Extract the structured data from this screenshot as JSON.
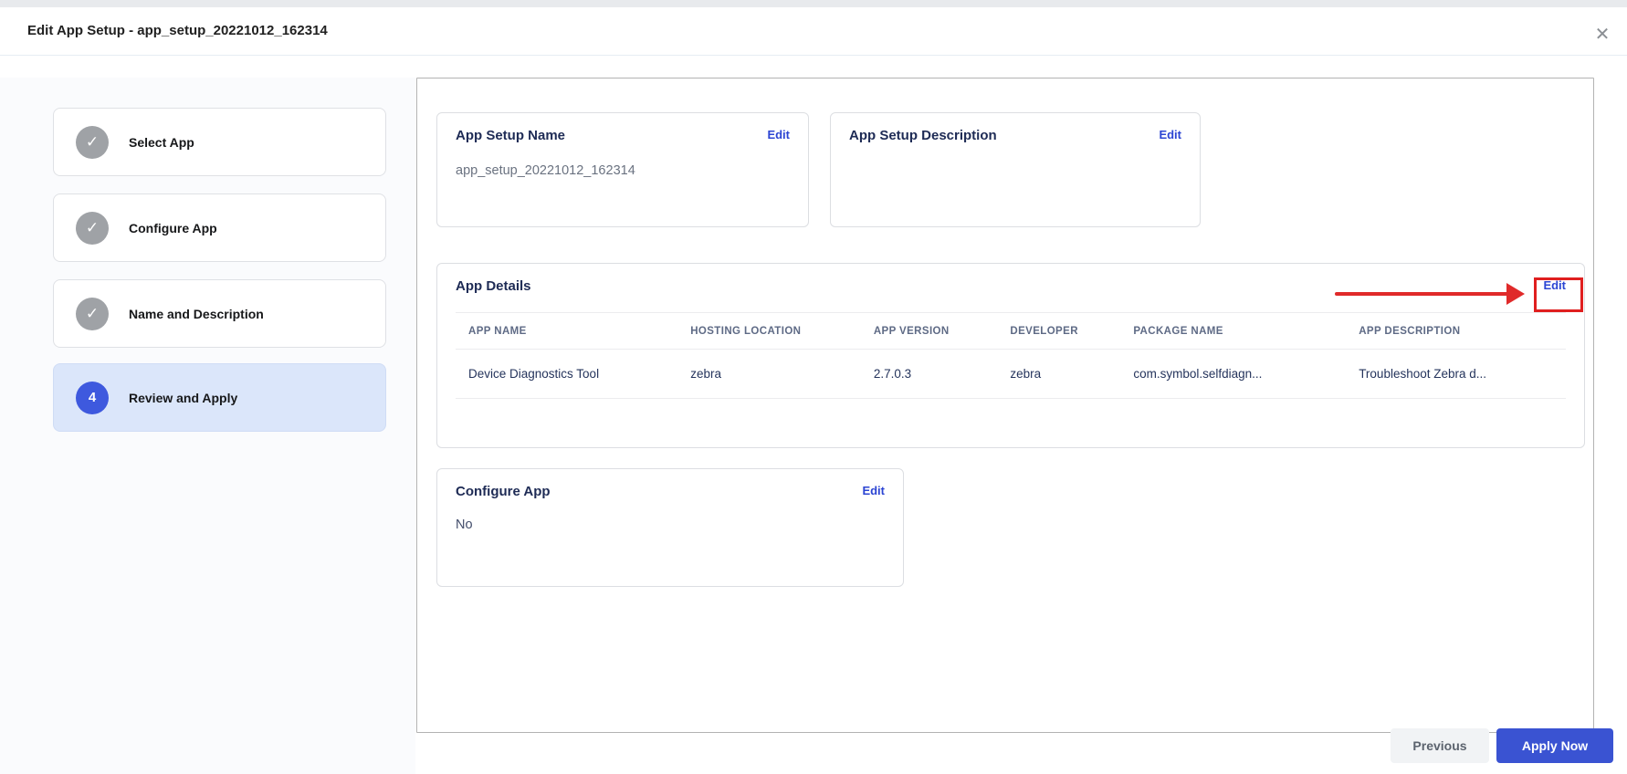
{
  "dialog": {
    "title": "Edit App Setup - app_setup_20221012_162314",
    "close_glyph": "✕"
  },
  "stepper": {
    "steps": [
      {
        "label": "Select App",
        "state": "completed"
      },
      {
        "label": "Configure App",
        "state": "completed"
      },
      {
        "label": "Name and Description",
        "state": "completed"
      },
      {
        "label": "Review and Apply",
        "state": "active",
        "number": "4"
      }
    ],
    "check_glyph": "✓"
  },
  "review": {
    "name_card": {
      "title": "App Setup Name",
      "action": "Edit",
      "value": "app_setup_20221012_162314"
    },
    "description_card": {
      "title": "App Setup Description",
      "action": "Edit",
      "value": ""
    },
    "details_card": {
      "title": "App Details",
      "action": "Edit",
      "columns": [
        "APP NAME",
        "HOSTING LOCATION",
        "APP VERSION",
        "DEVELOPER",
        "PACKAGE NAME",
        "APP DESCRIPTION"
      ],
      "row": [
        "Device Diagnostics Tool",
        "zebra",
        "2.7.0.3",
        "zebra",
        "com.symbol.selfdiagn...",
        "Troubleshoot Zebra d..."
      ]
    },
    "configure_card": {
      "title": "Configure App",
      "action": "Edit",
      "value": "No"
    }
  },
  "footer": {
    "previous_label": "Previous",
    "apply_label": "Apply Now"
  },
  "annotation": {
    "type": "red-arrow-pointing-to-edit",
    "target": "app-details-edit-link",
    "color": "#e02a2a"
  },
  "colors": {
    "accent_blue": "#3a53d2",
    "link_blue": "#2c45d3",
    "active_step_bg": "#dbe6fa",
    "step_circle_blue": "#3e59de",
    "completed_circle_gray": "#9fa2a6",
    "annotation_red": "#e02a2a",
    "title_navy": "#1e2b55"
  }
}
